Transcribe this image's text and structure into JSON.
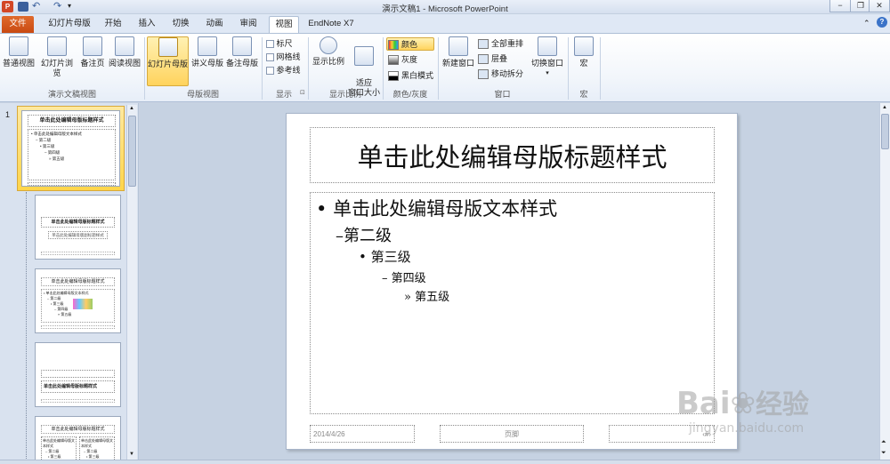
{
  "window": {
    "title": "演示文稿1 - Microsoft PowerPoint",
    "win_controls": [
      "−",
      "❐",
      "✕"
    ]
  },
  "tabs": [
    {
      "label": "文件"
    },
    {
      "label": "幻灯片母版"
    },
    {
      "label": "开始"
    },
    {
      "label": "插入"
    },
    {
      "label": "切换"
    },
    {
      "label": "动画"
    },
    {
      "label": "审阅"
    },
    {
      "label": "视图"
    },
    {
      "label": "EndNote X7"
    }
  ],
  "ribbon": {
    "presentation_views": {
      "label": "演示文稿视图",
      "buttons": [
        "普通视图",
        "幻灯片浏览",
        "备注页",
        "阅读视图"
      ]
    },
    "master_views": {
      "label": "母版视图",
      "buttons": [
        "幻灯片母版",
        "讲义母版",
        "备注母版"
      ]
    },
    "show": {
      "label": "显示",
      "checks": [
        "标尺",
        "网格线",
        "参考线"
      ]
    },
    "zoom": {
      "label": "显示比例",
      "buttons": [
        "显示比例",
        "适应\n窗口大小"
      ]
    },
    "color": {
      "label": "颜色/灰度",
      "items": [
        "颜色",
        "灰度",
        "黑白模式"
      ]
    },
    "window_group": {
      "label": "窗口",
      "new_window": "新建窗口",
      "items": [
        "全部重排",
        "层叠",
        "移动拆分"
      ],
      "switch": "切换窗口"
    },
    "macro": {
      "label": "宏",
      "button": "宏"
    }
  },
  "slide": {
    "title": "单击此处编辑母版标题样式",
    "levels": [
      {
        "bullet": "•",
        "text": "单击此处编辑母版文本样式"
      },
      {
        "bullet": "–",
        "text": "第二级"
      },
      {
        "bullet": "•",
        "text": "第三级"
      },
      {
        "bullet": "–",
        "text": "第四级"
      },
      {
        "bullet": "»",
        "text": "第五级"
      }
    ],
    "date": "2014/4/26",
    "footer": "页脚",
    "page_number": "‹#›"
  },
  "thumbnails": {
    "master_number": "1",
    "master_title": "单击此处编辑母版标题样式",
    "master_lines": [
      "• 单击此处编辑母版文本样式",
      "– 第二级",
      "• 第三级",
      "– 第四级",
      "» 第五级"
    ],
    "layout_titles": [
      "单击此处编辑母版标题样式",
      "单击此处编辑母版标题样式",
      "单击此处编辑母版标题样式",
      "单击此处编辑母版标题样式"
    ],
    "layout1_sub": "单击此处编辑母版副标题样式",
    "layout2_text": "• 单击此处编辑母版文本样式",
    "layout2_levels": [
      "– 第二级",
      "• 第三级",
      "– 第四级",
      "» 第五级"
    ],
    "layout4_text": "单击此处编辑母版文本样式",
    "layout4_levels": [
      "– 第二级",
      "• 第三级"
    ]
  },
  "watermark": {
    "brand": "Bai",
    "brand2": "经验",
    "url": "jingyan.baidu.com"
  },
  "colors": {
    "file_tab": "#d35a1c",
    "ribbon_active": "#ffd35d",
    "slide_bg": "#ffffff",
    "workspace": "#c6d2e2"
  }
}
